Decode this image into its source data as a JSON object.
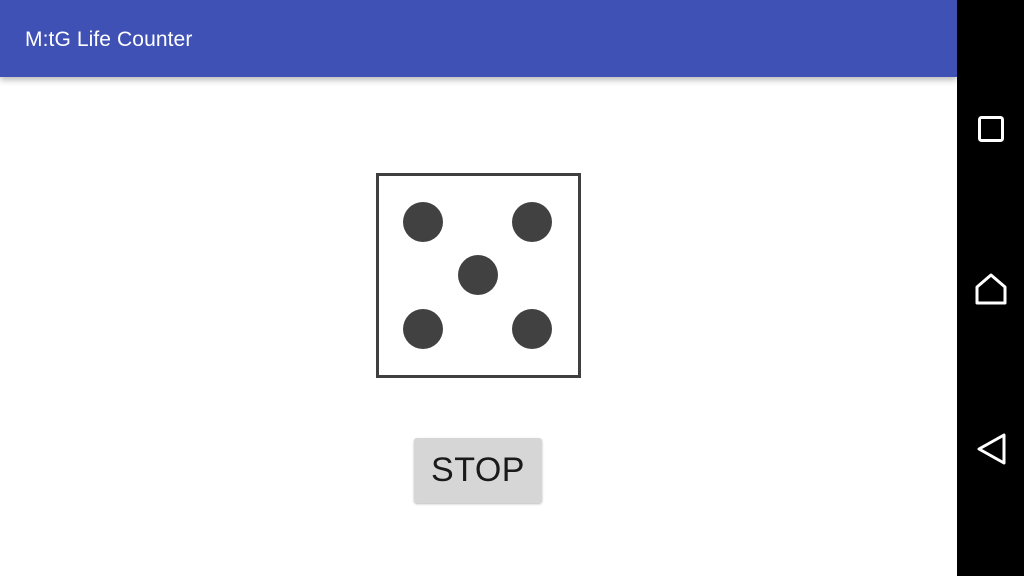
{
  "app_bar": {
    "title": "M:tG Life Counter",
    "background_color": "#3f51b5"
  },
  "die": {
    "face_value": 5,
    "pip_color": "#414141",
    "border_color": "#3f3f3f"
  },
  "stop_button": {
    "label": "STOP",
    "background_color": "#d6d6d6"
  },
  "navigation_bar": {
    "background_color": "#000000",
    "buttons": [
      {
        "icon": "square-recents-icon"
      },
      {
        "icon": "home-icon"
      },
      {
        "icon": "back-triangle-icon"
      }
    ]
  }
}
